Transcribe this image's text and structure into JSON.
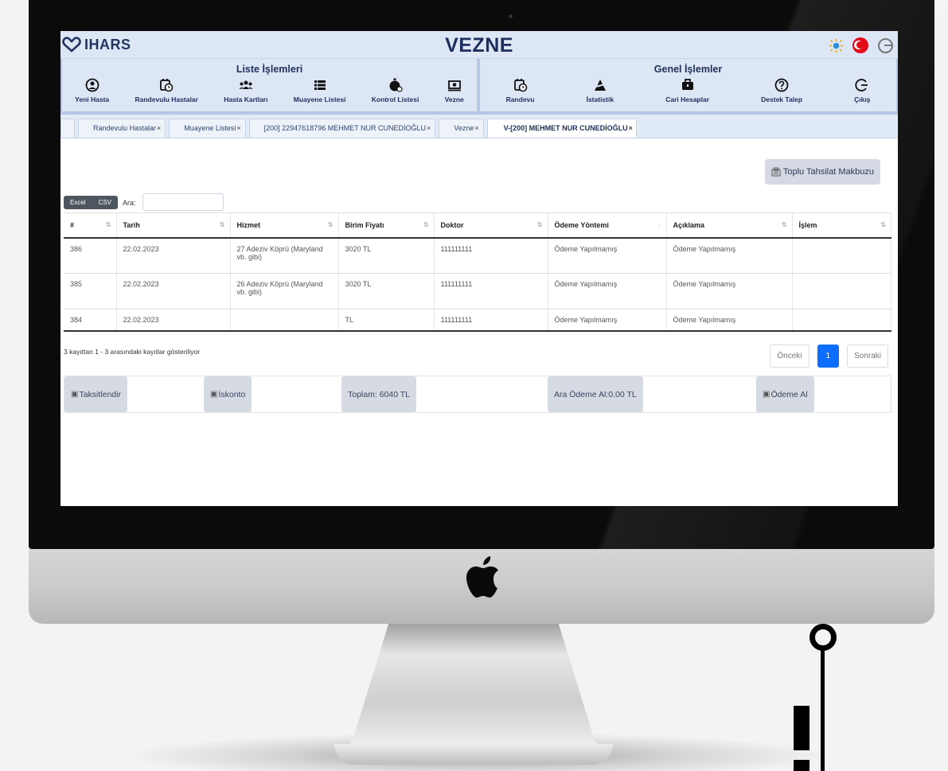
{
  "app": {
    "logo_text": "IHARS",
    "title": "VEZNE"
  },
  "menu": {
    "liste": {
      "title": "Liste İşlemleri",
      "items": [
        {
          "label": "Yeni Hasta",
          "icon": "user-circle-icon"
        },
        {
          "label": "Randevulu Hastalar",
          "icon": "calendar-clock-icon"
        },
        {
          "label": "Hasta Kartları",
          "icon": "users-icon"
        },
        {
          "label": "Muayene Listesi",
          "icon": "list-icon"
        },
        {
          "label": "Kontrol Listesi",
          "icon": "stopwatch-icon"
        },
        {
          "label": "Vezne",
          "icon": "money-icon"
        }
      ]
    },
    "genel": {
      "title": "Genel İşlemler",
      "items": [
        {
          "label": "Randevu",
          "icon": "calendar-clock-icon"
        },
        {
          "label": "İstatistik",
          "icon": "chart-icon"
        },
        {
          "label": "Cari Hesaplar",
          "icon": "briefcase-icon"
        },
        {
          "label": "Destek Talep",
          "icon": "question-icon"
        },
        {
          "label": "Çıkış",
          "icon": "logout-icon"
        }
      ]
    }
  },
  "tabs": [
    {
      "label": "Randevulu Hastalar"
    },
    {
      "label": "Muayene Listesi"
    },
    {
      "label": "[200] 22947618796 MEHMET NUR CUNEDİOĞLU"
    },
    {
      "label": "Vezne"
    },
    {
      "label": "V-[200] MEHMET NUR CUNEDİOĞLU"
    }
  ],
  "tab_close": "×",
  "toolbar": {
    "toplu_label": "Toplu Tahsilat Makbuzu",
    "excel_label": "Excel",
    "csv_label": "CSV",
    "search_label": "Ara:"
  },
  "table": {
    "headers": [
      "#",
      "Tarih",
      "Hizmet",
      "Birim Fiyatı",
      "Doktor",
      "Ödeme Yöntemi",
      "Açıklama",
      "İşlem"
    ],
    "rows": [
      [
        "386",
        "22.02.2023",
        "27 Adeziv Köprü (Maryland vb. gibi)",
        "3020 TL",
        "111111111",
        "Ödeme Yapılmamış",
        "Ödeme Yapılmamış",
        ""
      ],
      [
        "385",
        "22.02.2023",
        "26 Adeziv Köprü (Maryland vb. gibi)",
        "3020 TL",
        "111111111",
        "Ödeme Yapılmamış",
        "Ödeme Yapılmamış",
        ""
      ],
      [
        "384",
        "22.02.2023",
        "",
        "TL",
        "111111111",
        "Ödeme Yapılmamış",
        "Ödeme Yapılmamış",
        ""
      ]
    ]
  },
  "footer": {
    "info": "3 kayıttan 1 - 3 arasındaki kayıtlar gösteriliyor",
    "prev": "Önceki",
    "page": "1",
    "next": "Sonraki"
  },
  "actions": {
    "taksit": "Taksitlendir",
    "iskonto": "İskonto",
    "toplam": "Toplam: 6040 TL",
    "ara_odeme": "Ara Ödeme Al:0.00 TL",
    "odeme_al": "Ödeme Al"
  },
  "colors": {
    "header_bg": "#dde6f5",
    "primary_blue": "#0d6efd",
    "title_navy": "#1e2f5c"
  }
}
